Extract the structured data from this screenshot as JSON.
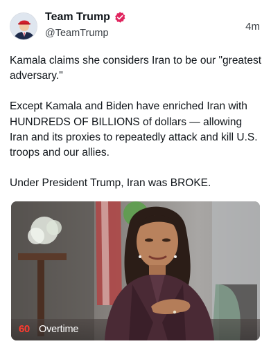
{
  "post": {
    "display_name": "Team Trump",
    "handle": "@TeamTrump",
    "timestamp": "4m",
    "verified_color": "#e0245e",
    "avatar_icon": "user-avatar",
    "paragraphs": [
      "Kamala claims she considers Iran to be our \"greatest adversary.\"",
      "Except Kamala and Biden have enriched Iran with HUNDREDS OF BILLIONS of dollars — allowing Iran and its proxies to repeatedly attack and kill U.S. troops and our allies.",
      "Under President Trump, Iran was BROKE."
    ]
  },
  "media": {
    "logo_number": "60",
    "logo_text": "Overtime"
  }
}
